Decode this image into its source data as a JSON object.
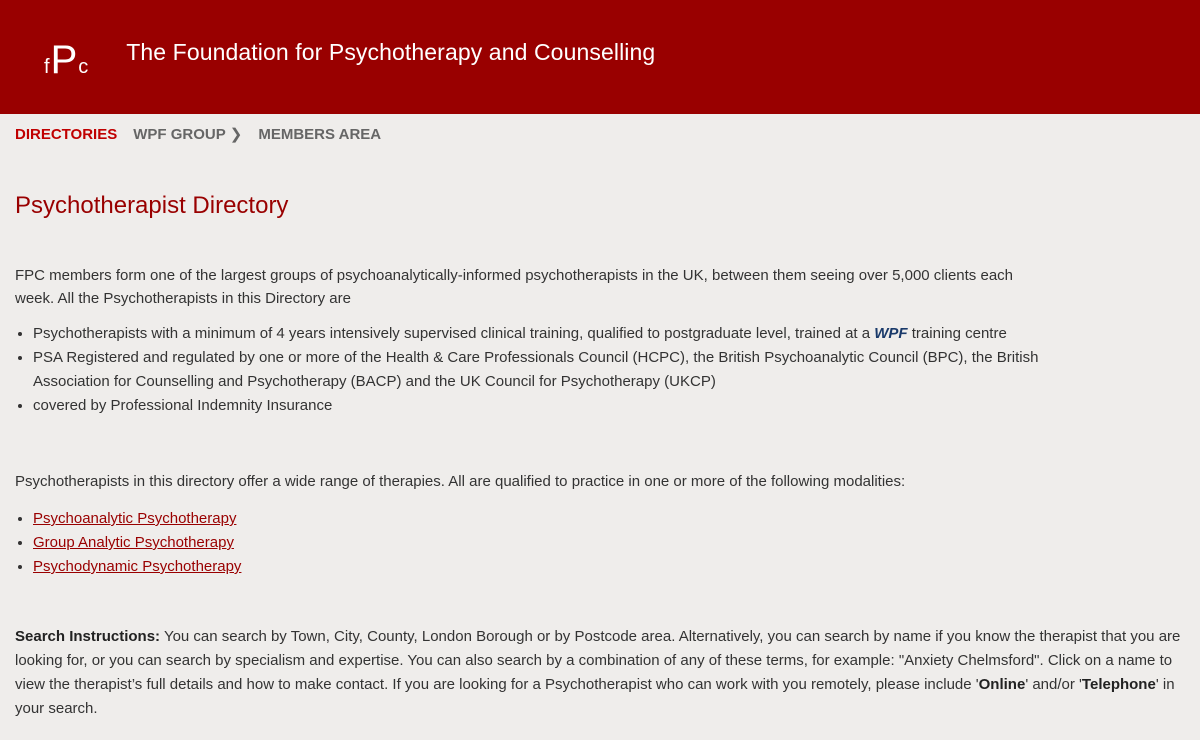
{
  "header": {
    "logo": {
      "l1": "f",
      "l2": "P",
      "l3": "c"
    },
    "title": "The Foundation for Psychotherapy and Counselling"
  },
  "nav": {
    "items": [
      {
        "label": "DIRECTORIES",
        "active": true
      },
      {
        "label": "WPF GROUP",
        "has_chevron": true
      },
      {
        "label": "MEMBERS AREA"
      }
    ]
  },
  "main": {
    "heading": "Psychotherapist Directory",
    "intro": "FPC members form one of the largest groups of psychoanalytically-informed psychotherapists in the UK, between them seeing over 5,000 clients each week. All the Psychotherapists in this Directory are",
    "features": {
      "f1_text": "Psychotherapists with a minimum of 4 years intensively supervised clinical training, qualified to postgraduate level, trained at a ",
      "f1_wpf": "WPF",
      "f1_tail": " training centre",
      "f2": "PSA Registered and regulated by one or more of the Health & Care Professionals Council (HCPC), the British Psychoanalytic Council (BPC), the British Association for Counselling and Psychotherapy (BACP) and the UK Council for Psychotherapy (UKCP)",
      "f3": "covered by Professional Indemnity Insurance"
    },
    "modalities_intro": "Psychotherapists in this directory offer a wide range of therapies. All are qualified to practice in one or more of the following modalities:",
    "modalities": [
      "Psychoanalytic Psychotherapy",
      "Group Analytic Psychotherapy",
      "Psychodynamic Psychotherapy"
    ],
    "search": {
      "label": "Search Instructions:",
      "text1": " You can search by Town, City, County, London Borough or by Postcode area. Alternatively, you can search by name if you know the therapist that you are looking for,  or you can search by specialism and expertise.  You can also search by a combination of any of these terms, for example: \"Anxiety Chelmsford\". Click on a name to view the therapist’s full details and how to make contact. If you are looking for a Psychotherapist who can work with you remotely, please include '",
      "online": "Online",
      "text2": "' and/or '",
      "telephone": "Telephone",
      "text3": "' in your search."
    }
  }
}
